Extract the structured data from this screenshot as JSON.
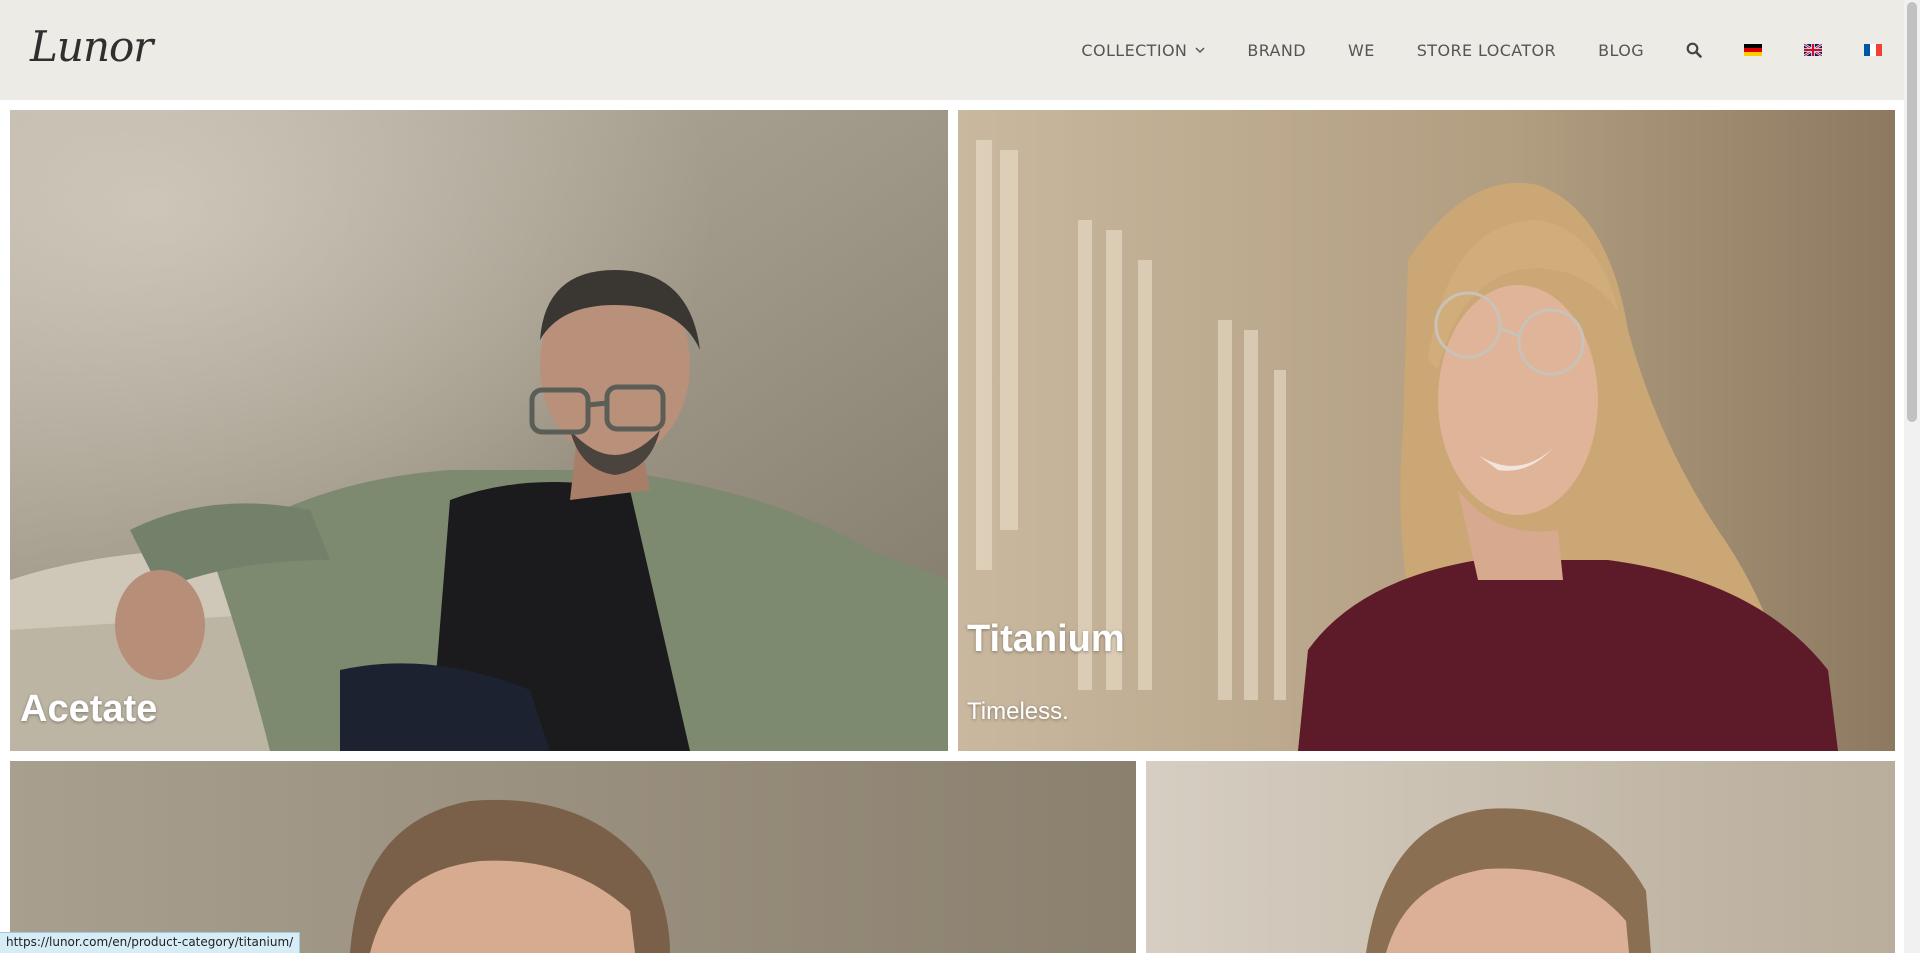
{
  "brand": {
    "logo_text": "Lunor"
  },
  "nav": {
    "items": [
      {
        "label": "COLLECTION",
        "has_dropdown": true
      },
      {
        "label": "BRAND"
      },
      {
        "label": "WE"
      },
      {
        "label": "STORE LOCATOR"
      },
      {
        "label": "BLOG"
      }
    ],
    "search_icon": "search-icon",
    "languages": [
      {
        "code": "de",
        "icon": "flag-germany-icon"
      },
      {
        "code": "en",
        "icon": "flag-uk-icon"
      },
      {
        "code": "fr",
        "icon": "flag-france-icon"
      }
    ]
  },
  "tiles": [
    {
      "title": "Acetate",
      "subtitle": ""
    },
    {
      "title": "Titanium",
      "subtitle": "Timeless."
    }
  ],
  "status_bar": {
    "url": "https://lunor.com/en/product-category/titanium/"
  },
  "colors": {
    "header_bg": "#edebe6",
    "nav_text": "#555555",
    "tile_text": "#ffffff"
  }
}
